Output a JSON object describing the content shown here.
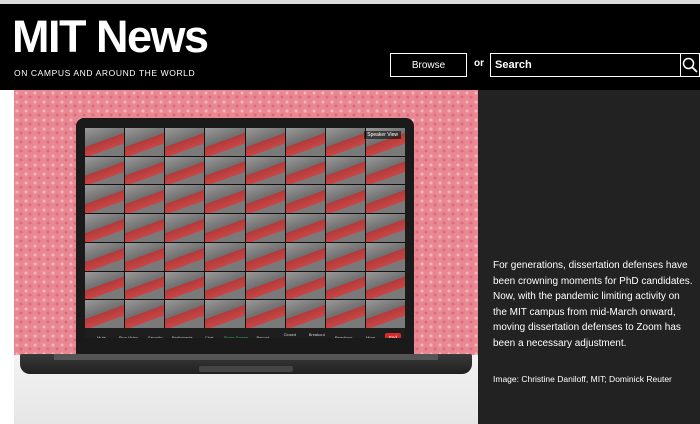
{
  "header": {
    "logo": "MIT News",
    "tagline": "ON CAMPUS AND AROUND THE WORLD",
    "browse_label": "Browse",
    "or_label": "or",
    "search_placeholder": "Search"
  },
  "hero": {
    "zoom": {
      "speaker_view_label": "Speaker View",
      "toolbar_items": [
        "Mute",
        "Stop Video",
        "Security",
        "Participants",
        "Chat",
        "Share Screen",
        "Record",
        "Closed Caption",
        "Breakout Rooms",
        "Reactions",
        "More"
      ],
      "end_label": "End"
    },
    "caption": "For generations, dissertation defenses have been crowning moments for PhD candidates. Now, with the pandemic limiting activity on the MIT campus from mid-March onward, moving dissertation defenses to Zoom has been a necessary adjustment.",
    "credit": "Image: Christine Daniloff, MIT; Dominick Reuter"
  },
  "colors": {
    "header_bg": "#000000",
    "caption_bg": "#222222",
    "hero_backdrop": "#e98892",
    "zoom_end": "#d72b2b"
  }
}
